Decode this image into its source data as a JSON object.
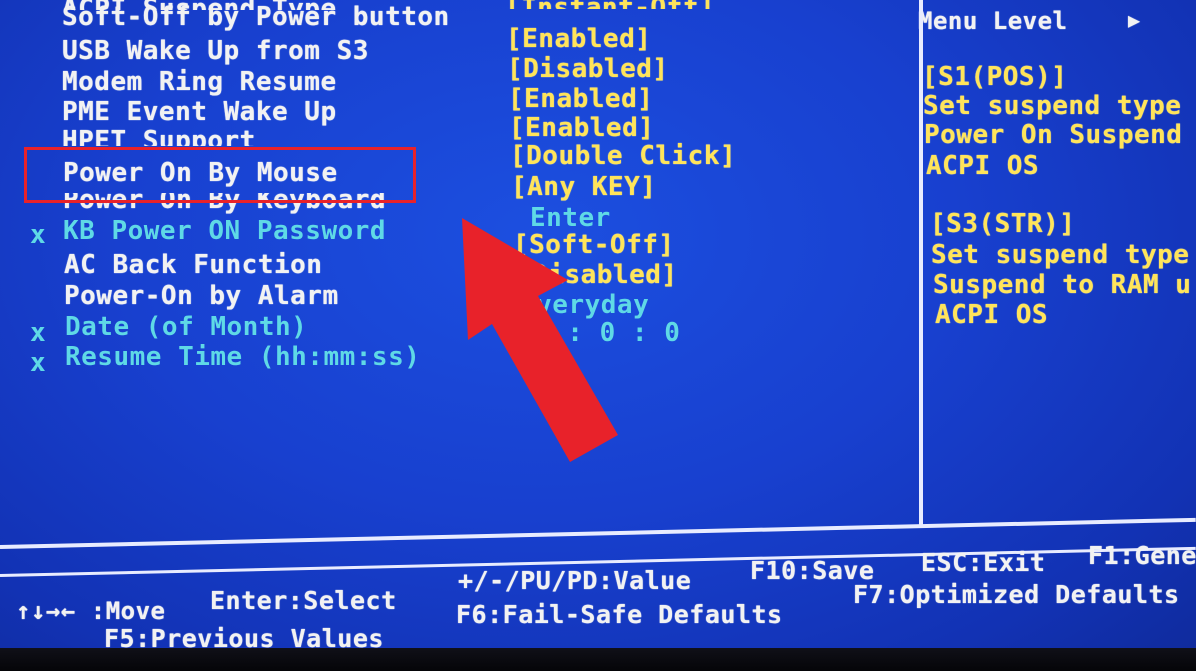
{
  "settings": {
    "top_cut_row": "ACPI Suspend Type",
    "rows": [
      {
        "label": "Soft-Off by Power button",
        "value": "[Instant-Off]"
      },
      {
        "label": "USB Wake Up from S3",
        "value": "[Enabled]"
      },
      {
        "label": "Modem Ring Resume",
        "value": "[Disabled]"
      },
      {
        "label": "PME Event Wake Up",
        "value": "[Enabled]"
      },
      {
        "label": "HPET Support",
        "value": "[Enabled]"
      },
      {
        "label": "Power On By Mouse",
        "value": "[Double Click]"
      },
      {
        "label": "Power On By Keyboard",
        "value": "[Any KEY]"
      },
      {
        "prefix": "x",
        "label": "KB Power ON Password",
        "value": "Enter"
      },
      {
        "label": "AC Back Function",
        "value": "[Soft-Off]"
      },
      {
        "label": "Power-On by Alarm",
        "value": "[Disabled]"
      },
      {
        "prefix": "x",
        "label": "Date (of Month)",
        "value": "Everyday"
      },
      {
        "prefix": "x",
        "label": "Resume Time (hh:mm:ss)",
        "value": "0 : 0 : 0"
      }
    ]
  },
  "help": {
    "menu_level": "Menu Level",
    "menu_level_arrow": "▶",
    "s1_title": "[S1(POS)]",
    "s1_line1": "Set suspend type",
    "s1_line2": "Power On Suspend",
    "s1_line3": "ACPI OS",
    "s3_title": "[S3(STR)]",
    "s3_line1": "Set suspend type",
    "s3_line2": "Suspend to RAM u",
    "s3_line3": "ACPI OS"
  },
  "footer": {
    "move": "↑↓→← :Move",
    "select": "Enter:Select",
    "value": "+/-/PU/PD:Value",
    "save": "F10:Save",
    "exit": "ESC:Exit",
    "general": "F1:Gene",
    "previous": "F5:Previous Values",
    "failsafe": "F6:Fail-Safe Defaults",
    "optimized": "F7:Optimized Defaults"
  },
  "colors": {
    "background": "#1840cf",
    "item_text": "#f2f2f2",
    "value_text": "#ffe45a",
    "disabled_text": "#5fd9e6",
    "highlight": "#e8222a"
  }
}
